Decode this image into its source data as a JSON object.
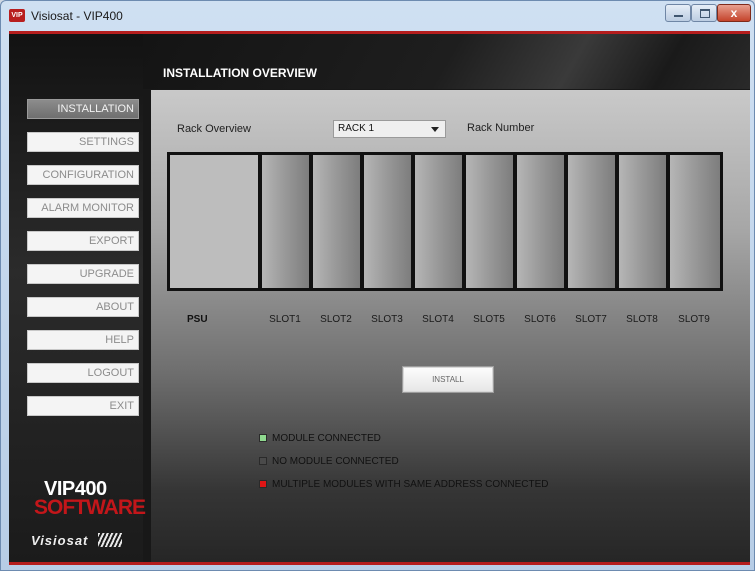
{
  "window": {
    "title": "Visiosat - VIP400",
    "app_icon_text": "VIP",
    "close_label": "x"
  },
  "sidebar": {
    "items": [
      {
        "label": "INSTALLATION",
        "active": true
      },
      {
        "label": "SETTINGS",
        "active": false
      },
      {
        "label": "CONFIGURATION",
        "active": false
      },
      {
        "label": "ALARM MONITOR",
        "active": false
      },
      {
        "label": "EXPORT",
        "active": false
      },
      {
        "label": "UPGRADE",
        "active": false
      },
      {
        "label": "ABOUT",
        "active": false
      },
      {
        "label": "HELP",
        "active": false
      },
      {
        "label": "LOGOUT",
        "active": false
      },
      {
        "label": "EXIT",
        "active": false
      }
    ],
    "logo": {
      "line1": "VIP400",
      "line2": "SOFTWARE",
      "brand": "Visiosat"
    }
  },
  "header": {
    "title": "INSTALLATION OVERVIEW"
  },
  "main": {
    "rack_overview_label": "Rack Overview",
    "rack_select_value": "RACK 1",
    "rack_number_label": "Rack Number",
    "psu_label": "PSU",
    "slots": [
      "SLOT1",
      "SLOT2",
      "SLOT3",
      "SLOT4",
      "SLOT5",
      "SLOT6",
      "SLOT7",
      "SLOT8",
      "SLOT9"
    ],
    "install_button": "INSTALL",
    "legend": [
      {
        "label": "MODULE CONNECTED",
        "color": "#8fd98f"
      },
      {
        "label": "NO MODULE CONNECTED",
        "color": "#4a4a4a"
      },
      {
        "label": "MULTIPLE MODULES WITH SAME ADDRESS CONNECTED",
        "color": "#e01515"
      }
    ]
  },
  "colors": {
    "accent_red": "#b41d1d",
    "sidebar_bg": "#1b1b1b"
  }
}
